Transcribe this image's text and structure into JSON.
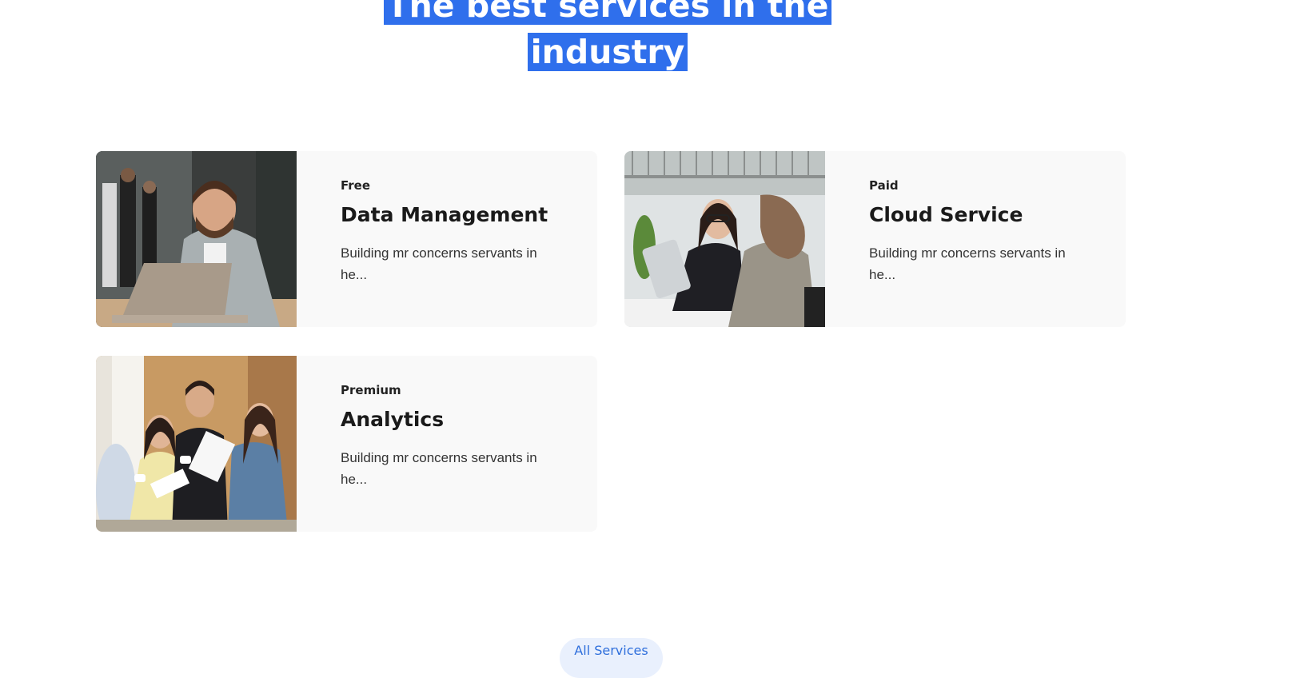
{
  "section": {
    "heading_line1": "The best services in the",
    "heading_line2": "industry"
  },
  "services": [
    {
      "tier": "Free",
      "title": "Data Management",
      "description": "Building mr concerns servants in he...",
      "image_alt": "man with laptop"
    },
    {
      "tier": "Paid",
      "title": "Cloud Service",
      "description": "Building mr concerns servants in he...",
      "image_alt": "two women meeting with tablet"
    },
    {
      "tier": "Premium",
      "title": "Analytics",
      "description": "Building mr concerns servants in he...",
      "image_alt": "team discussing documents"
    }
  ],
  "actions": {
    "all_services_label": "All Services"
  },
  "colors": {
    "selection": "#2f6fec",
    "card_bg": "#f9f9f9",
    "button_bg": "#e9f0fd",
    "button_text": "#2f6fdc"
  }
}
